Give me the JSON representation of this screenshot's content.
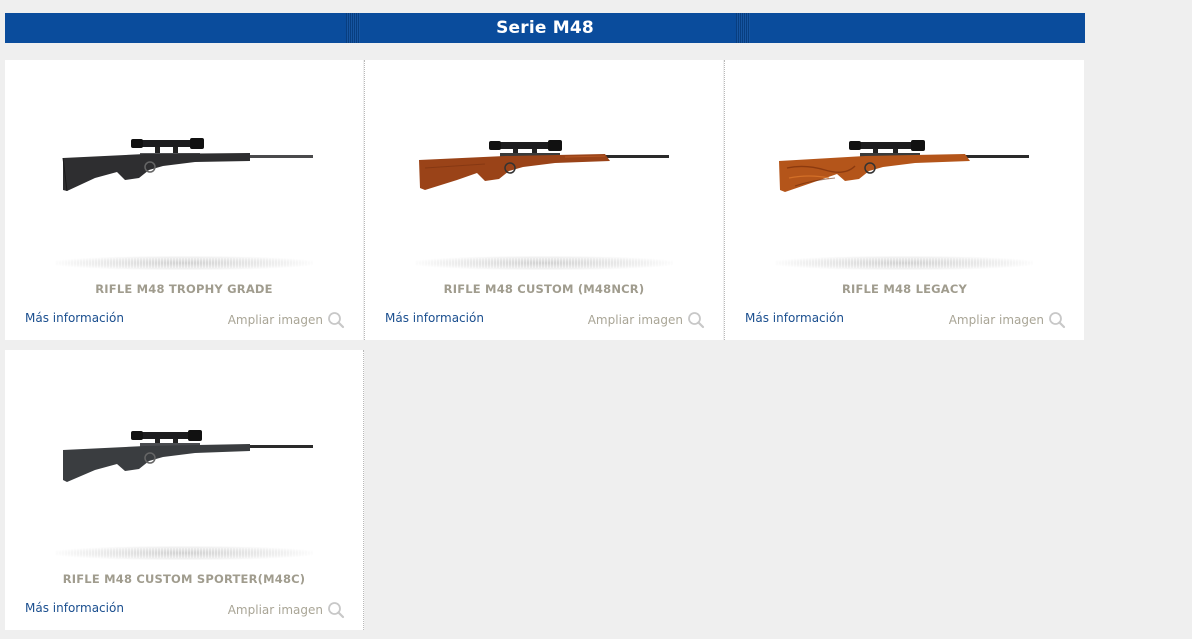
{
  "section": {
    "title": "Serie M48"
  },
  "products": [
    {
      "name": "RIFLE M48 TROPHY GRADE",
      "more_info": "Más información",
      "zoom": "Ampliar imagen",
      "stock_color": "#2e2e30",
      "stock_type": "synthetic"
    },
    {
      "name": "RIFLE M48 CUSTOM (M48NCR)",
      "more_info": "Más información",
      "zoom": "Ampliar imagen",
      "stock_color": "#9a4318",
      "stock_type": "wood"
    },
    {
      "name": "RIFLE M48 LEGACY",
      "more_info": "Más información",
      "zoom": "Ampliar imagen",
      "stock_color": "#b4551a",
      "stock_type": "wood-figured"
    },
    {
      "name": "RIFLE M48 CUSTOM SPORTER(M48C)",
      "more_info": "Más información",
      "zoom": "Ampliar imagen",
      "stock_color": "#3a3d40",
      "stock_type": "synthetic"
    }
  ],
  "colors": {
    "header_bg": "#0a4c9c",
    "link": "#1b4f8f",
    "muted": "#a09c8e",
    "page_bg": "#efefef"
  },
  "icons": {
    "zoom": "magnifier-icon"
  }
}
